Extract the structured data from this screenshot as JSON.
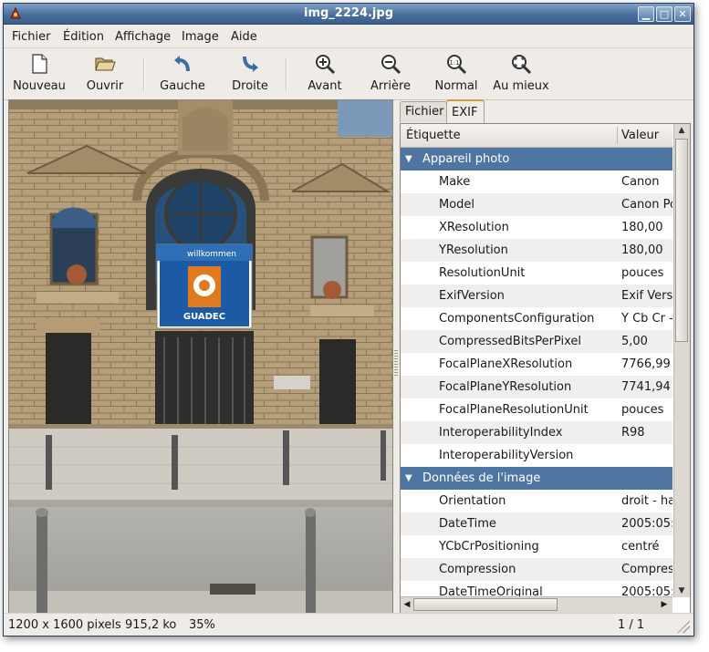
{
  "window": {
    "title": "img_2224.jpg",
    "buttons": {
      "minimize": "▁",
      "maximize": "□",
      "close": "✕"
    }
  },
  "menu": [
    {
      "label": "Fichier"
    },
    {
      "label": "Édition"
    },
    {
      "label": "Affichage"
    },
    {
      "label": "Image"
    },
    {
      "label": "Aide"
    }
  ],
  "toolbar": {
    "new": "Nouveau",
    "open": "Ouvrir",
    "left": "Gauche",
    "right": "Droite",
    "forward": "Avant",
    "back": "Arrière",
    "normal": "Normal",
    "fit": "Au mieux"
  },
  "tabs": {
    "file": "Fichier",
    "exif": "EXIF"
  },
  "exif": {
    "col_label": "Étiquette",
    "col_value": "Valeur",
    "rows": [
      {
        "type": "group",
        "label": "Appareil photo",
        "value": ""
      },
      {
        "type": "item",
        "label": "Make",
        "value": "Canon"
      },
      {
        "type": "item",
        "label": "Model",
        "value": "Canon Po"
      },
      {
        "type": "item",
        "label": "XResolution",
        "value": "180,00"
      },
      {
        "type": "item",
        "label": "YResolution",
        "value": "180,00"
      },
      {
        "type": "item",
        "label": "ResolutionUnit",
        "value": "pouces"
      },
      {
        "type": "item",
        "label": "ExifVersion",
        "value": "Exif Vers"
      },
      {
        "type": "item",
        "label": "ComponentsConfiguration",
        "value": "Y Cb Cr -"
      },
      {
        "type": "item",
        "label": "CompressedBitsPerPixel",
        "value": "5,00"
      },
      {
        "type": "item",
        "label": "FocalPlaneXResolution",
        "value": "7766,99"
      },
      {
        "type": "item",
        "label": "FocalPlaneYResolution",
        "value": "7741,94"
      },
      {
        "type": "item",
        "label": "FocalPlaneResolutionUnit",
        "value": "pouces"
      },
      {
        "type": "item",
        "label": "InteroperabilityIndex",
        "value": "R98"
      },
      {
        "type": "item",
        "label": "InteroperabilityVersion",
        "value": ""
      },
      {
        "type": "group",
        "label": "Données de l'image",
        "value": ""
      },
      {
        "type": "item",
        "label": "Orientation",
        "value": "droit - ha"
      },
      {
        "type": "item",
        "label": "DateTime",
        "value": "2005:05:"
      },
      {
        "type": "item",
        "label": "YCbCrPositioning",
        "value": "centré"
      },
      {
        "type": "item",
        "label": "Compression",
        "value": "Compres"
      },
      {
        "type": "item",
        "label": "DateTimeOriginal",
        "value": "2005:05:"
      }
    ]
  },
  "banner": {
    "top": "willkommen",
    "name": "GUADEC"
  },
  "status": {
    "dimensions": "1200 x 1600 pixels",
    "size": "915,2 ko",
    "zoom": "35%",
    "page": "1 / 1"
  },
  "colors": {
    "selection": "#4f75a3",
    "title_bar": "#4a6f9c",
    "tab_accent": "#d79a3a"
  }
}
